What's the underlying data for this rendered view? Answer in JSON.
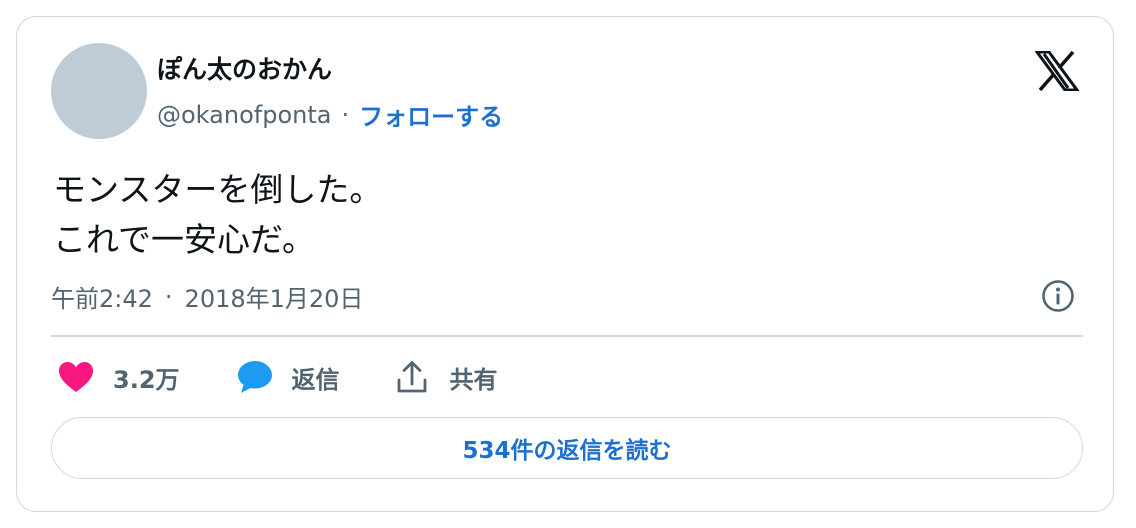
{
  "author": {
    "name": "ぽん太のおかん",
    "handle": "@okanofponta",
    "separator": "·",
    "follow_label": "フォローする"
  },
  "brand": {
    "icon": "x-logo-icon"
  },
  "tweet": {
    "lines": [
      "モンスターを倒した。",
      "これで一安心だ。"
    ]
  },
  "meta": {
    "time": "午前2:42",
    "separator": "·",
    "date": "2018年1月20日",
    "info_icon": "info-icon"
  },
  "actions": {
    "like": {
      "icon": "heart-icon",
      "count": "3.2万",
      "color": "#f91880"
    },
    "reply": {
      "icon": "speech-bubble-icon",
      "label": "返信",
      "color": "#1d9bf0"
    },
    "share": {
      "icon": "share-upload-icon",
      "label": "共有"
    }
  },
  "read_replies": {
    "label": "534件の返信を読む"
  },
  "colors": {
    "accent": "#1d6fd1",
    "muted": "#536471",
    "border": "#cfd9de",
    "avatar": "#bfccd6"
  }
}
